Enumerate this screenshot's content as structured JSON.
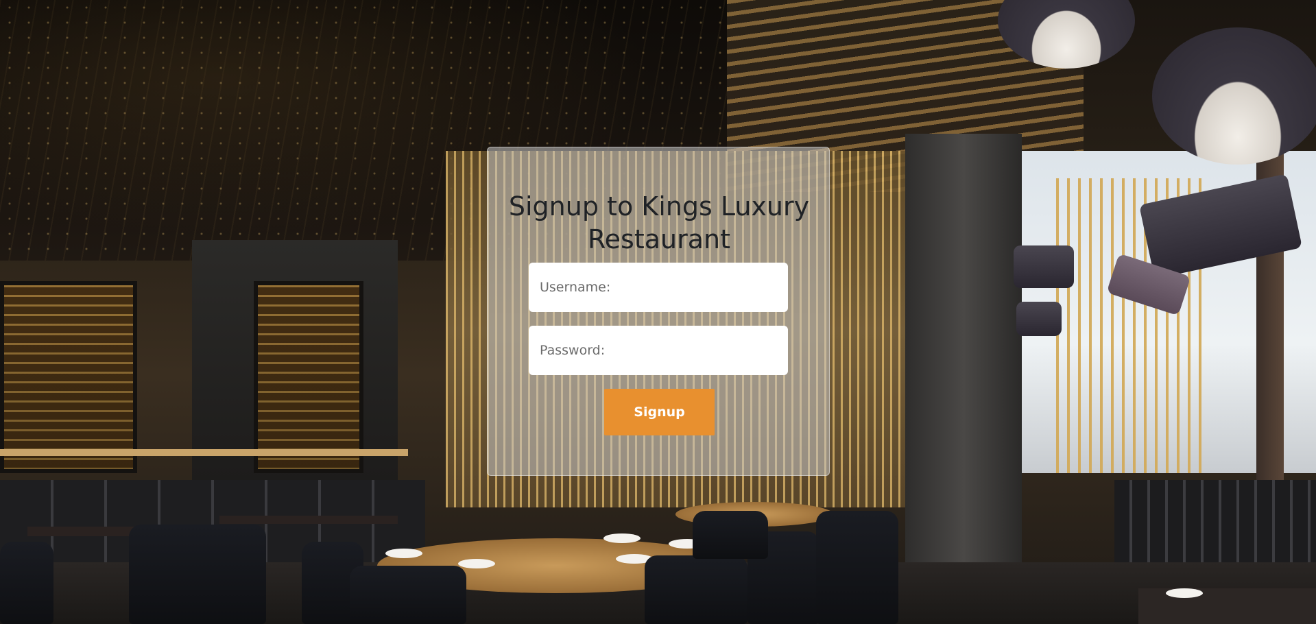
{
  "background": {
    "scene": "restaurant-interior-photo"
  },
  "signup_form": {
    "title": "Signup to Kings Luxury Restaurant",
    "username": {
      "placeholder": "Username:",
      "value": ""
    },
    "password": {
      "placeholder": "Password:",
      "value": ""
    },
    "submit_label": "Signup"
  },
  "colors": {
    "button": "#e8902f",
    "card": "rgba(200,200,200,0.55)",
    "title_text": "#1f2226"
  }
}
